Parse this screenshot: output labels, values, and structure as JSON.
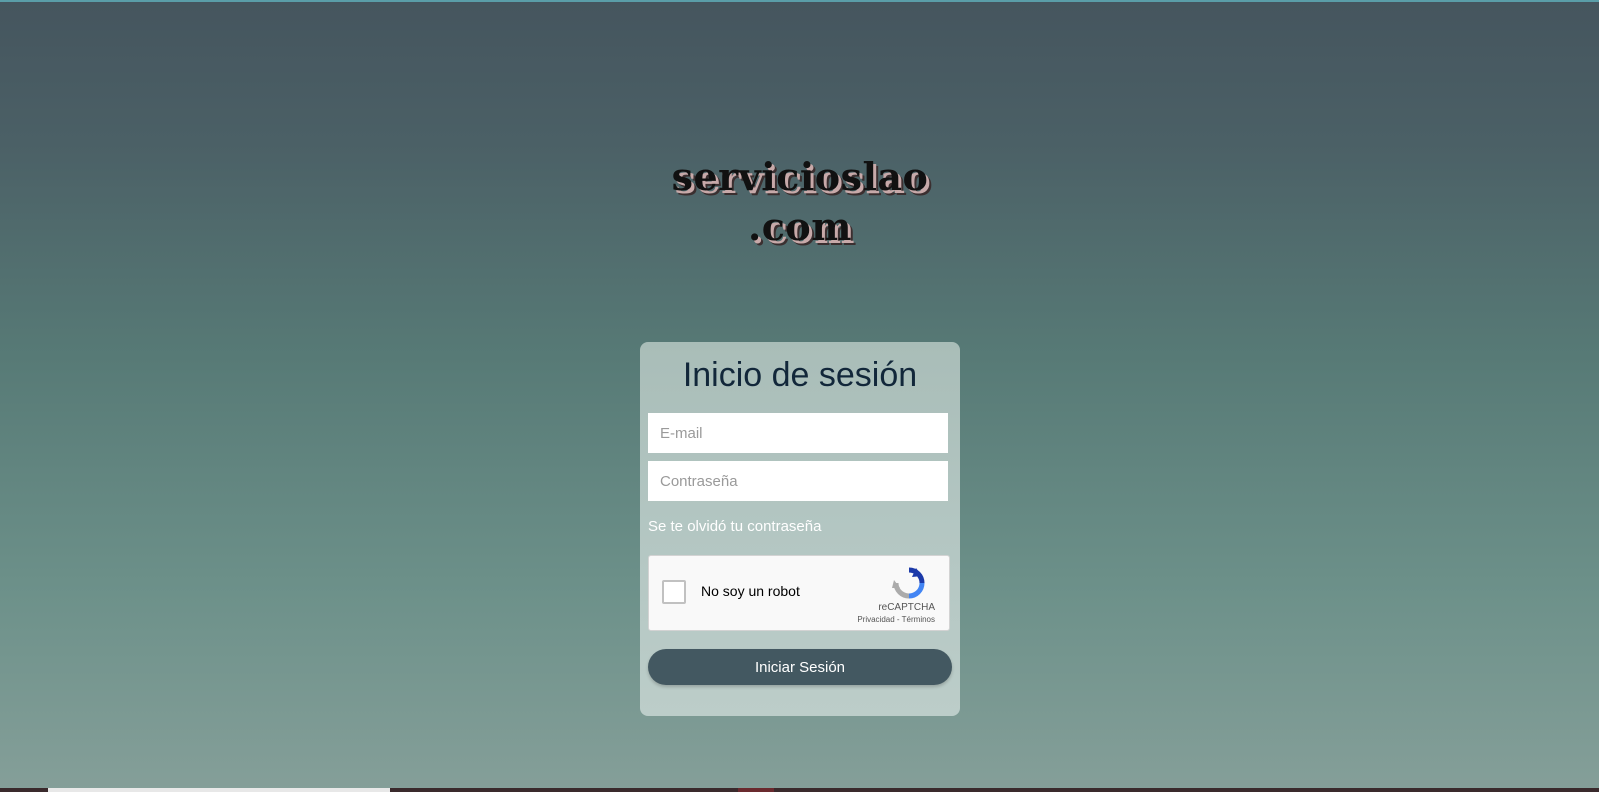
{
  "brand": {
    "line1": "servicioslao",
    "line2": ".com"
  },
  "login": {
    "title": "Inicio de sesión",
    "email_placeholder": "E-mail",
    "password_placeholder": "Contraseña",
    "forgot_link": "Se te olvidó tu contraseña",
    "submit_label": "Iniciar Sesión"
  },
  "recaptcha": {
    "label": "No soy un robot",
    "brand": "reCAPTCHA",
    "privacy_link": "Privacidad",
    "separator": " - ",
    "terms_link": "Términos",
    "checked": false
  },
  "colors": {
    "button": "#435861",
    "title": "#12273a",
    "card": "#b3c6c2"
  }
}
